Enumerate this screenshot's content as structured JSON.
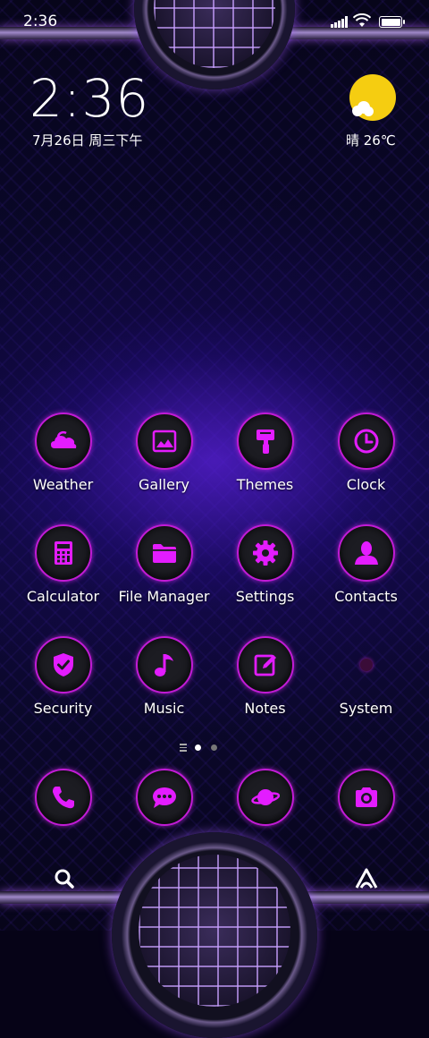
{
  "status_bar": {
    "time": "2:36"
  },
  "clock_widget": {
    "time": "2:36",
    "date": "7月26日 周三下午"
  },
  "weather_widget": {
    "text": "晴 26℃",
    "icon": "sunny-cloud-icon"
  },
  "colors": {
    "accent": "#c21bd6",
    "icon_glyph": "#e31cff",
    "sun": "#f5cd11"
  },
  "apps": [
    {
      "label": "Weather",
      "icon": "weather-cloud-icon"
    },
    {
      "label": "Gallery",
      "icon": "gallery-image-icon"
    },
    {
      "label": "Themes",
      "icon": "paint-brush-icon"
    },
    {
      "label": "Clock",
      "icon": "clock-icon"
    },
    {
      "label": "Calculator",
      "icon": "calculator-icon"
    },
    {
      "label": "File Manager",
      "icon": "folder-icon"
    },
    {
      "label": "Settings",
      "icon": "gear-icon"
    },
    {
      "label": "Contacts",
      "icon": "person-icon"
    },
    {
      "label": "Security",
      "icon": "shield-check-icon"
    },
    {
      "label": "Music",
      "icon": "music-note-icon"
    },
    {
      "label": "Notes",
      "icon": "note-edit-icon"
    },
    {
      "label": "System",
      "icon": "system-folder-icon"
    }
  ],
  "dock": [
    {
      "icon": "phone-icon"
    },
    {
      "icon": "message-icon"
    },
    {
      "icon": "browser-planet-icon"
    },
    {
      "icon": "camera-icon"
    }
  ],
  "pagination": {
    "pages": 2,
    "current": 1
  },
  "bottom_bar": {
    "search_icon": "search-icon",
    "launcher_icon": "launcher-icon"
  }
}
